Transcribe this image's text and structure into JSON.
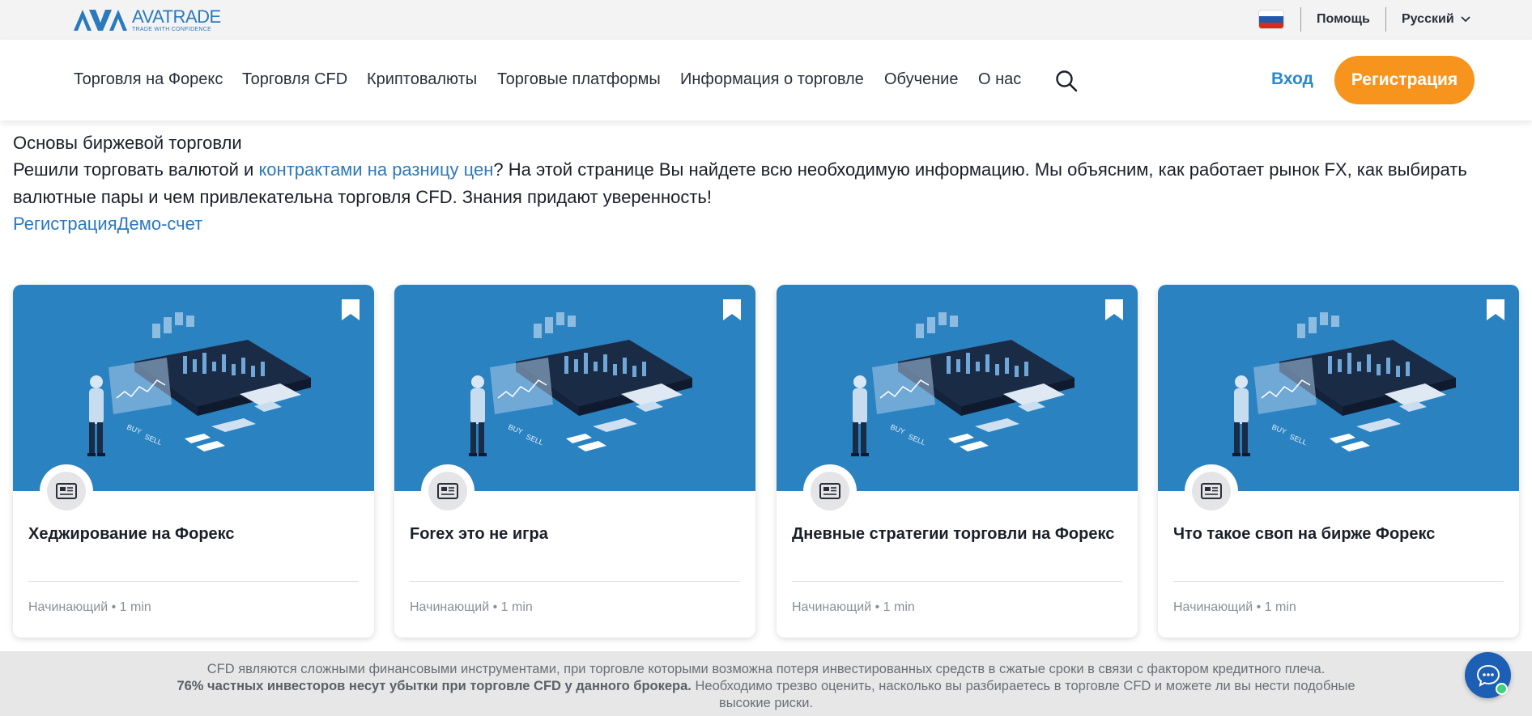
{
  "brand": {
    "name": "AVATRADE",
    "tagline": "TRADE WITH CONFIDENCE",
    "color": "#2b79bd"
  },
  "topbar": {
    "flag_icon": "russian-flag-icon",
    "help_label": "Помощь",
    "language_label": "Русский"
  },
  "nav": {
    "items": [
      {
        "label": "Торговля на Форекс"
      },
      {
        "label": "Торговля CFD"
      },
      {
        "label": "Криптовалюты"
      },
      {
        "label": "Торговые платформы"
      },
      {
        "label": "Информация о торговле"
      },
      {
        "label": "Обучение"
      },
      {
        "label": "О нас"
      }
    ],
    "search_icon": "search-icon",
    "login_label": "Вход",
    "register_label": "Регистрация",
    "accent_color": "#f7941d"
  },
  "intro": {
    "title": "Основы биржевой торговли",
    "text_before_link": "Решили торговать валютой и ",
    "link_text": "контрактами на разницу цен",
    "text_after_link": "? На этой странице Вы найдете всю необходимую информацию. Мы объясним, как работает рынок FX, как выбирать валютные пары и чем привлекательна торговля CFD. Знания придают уверенность!",
    "cta_register": "Регистрация",
    "cta_demo": "Демо-счет"
  },
  "cards": [
    {
      "title": "Хеджирование на Форекс",
      "level": "Начинающий",
      "separator": " • ",
      "duration": "1 min"
    },
    {
      "title": "Forex это не игра",
      "level": "Начинающий",
      "separator": " • ",
      "duration": "1 min"
    },
    {
      "title": "Дневные стратегии торговли на Форекс",
      "level": "Начинающий",
      "separator": " • ",
      "duration": "1 min"
    },
    {
      "title": "Что такое своп на бирже Форекс",
      "level": "Начинающий",
      "separator": " • ",
      "duration": "1 min"
    }
  ],
  "disclaimer": {
    "line1": "CFD являются сложными финансовыми инструментами, при торговле которыми возможна потеря инвестированных средств в сжатые сроки в связи с фактором кредитного плеча.",
    "bold": "76% частных инвесторов несут убытки при торговле CFD у данного брокера.",
    "rest": " Необходимо трезво оценить, насколько вы разбираетесь в торговле CFD и можете ли вы нести подобные высокие риски."
  },
  "chat": {
    "icon": "chat-bubble-icon",
    "status_color": "#3ed37a"
  }
}
